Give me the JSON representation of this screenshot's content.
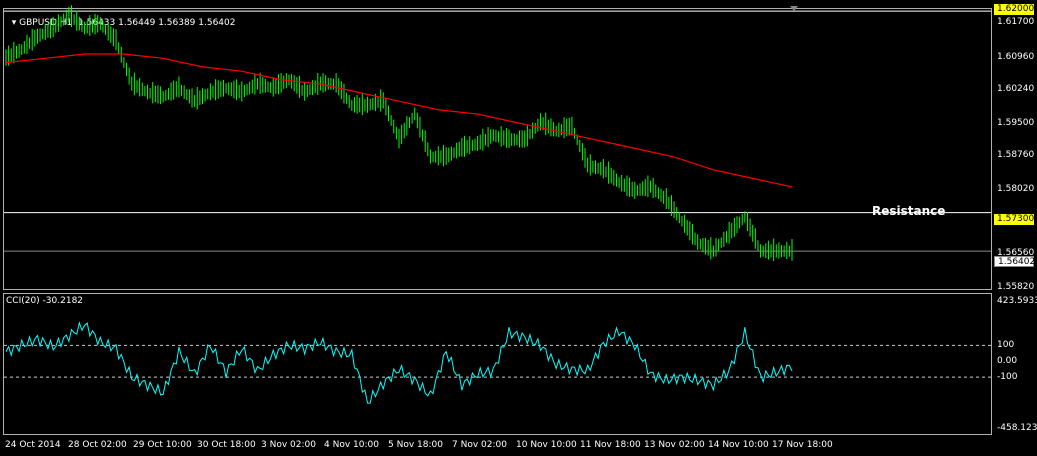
{
  "header": {
    "symbol": "GBPUSD,H1",
    "ohlc": "1.56433 1.56449 1.56389 1.56402"
  },
  "cci": {
    "label": "CCI(20) -30.2182",
    "axis": [
      "423.5933",
      "100",
      "0.00",
      "-100",
      "-458.1239"
    ]
  },
  "price_axis": [
    "1.61700",
    "1.60960",
    "1.60240",
    "1.59500",
    "1.58760",
    "1.58020",
    "1.56560",
    "1.55820"
  ],
  "tags": {
    "top_level": "1.62000",
    "resistance_level": "1.57300",
    "current_price": "1.56402"
  },
  "annotation": {
    "resistance": "Resistance"
  },
  "time_axis": [
    "24 Oct 2014",
    "28 Oct 02:00",
    "29 Oct 10:00",
    "30 Oct 18:00",
    "3 Nov 02:00",
    "4 Nov 10:00",
    "5 Nov 18:00",
    "7 Nov 02:00",
    "10 Nov 10:00",
    "11 Nov 18:00",
    "13 Nov 02:00",
    "14 Nov 10:00",
    "17 Nov 18:00"
  ],
  "colors": {
    "bars": "#00ff00",
    "ma": "#ff0000",
    "cci": "#00ffff",
    "background": "#000000",
    "levels": "#ffffff"
  },
  "chart_data": [
    {
      "type": "line",
      "series": [
        {
          "values": [
            1.609,
            1.611,
            1.614,
            1.616,
            1.619,
            1.616,
            1.617,
            1.613,
            1.603,
            1.601,
            1.6,
            1.602,
            1.599,
            1.601,
            1.602,
            1.601,
            1.603,
            1.602,
            1.604,
            1.601,
            1.603,
            1.603,
            1.598,
            1.598,
            1.599,
            1.59,
            1.596,
            1.586,
            1.586,
            1.588,
            1.589,
            1.591,
            1.59,
            1.59,
            1.594,
            1.592,
            1.593,
            1.584,
            1.583,
            1.58,
            1.578,
            1.579,
            1.576,
            1.571,
            1.566,
            1.564,
            1.568,
            1.572,
            1.564,
            1.564,
            1.564
          ]
        },
        {
          "values": [
            1.608,
            1.609,
            1.61,
            1.61,
            1.609,
            1.607,
            1.606,
            1.604,
            1.603,
            1.601,
            1.599,
            1.597,
            1.596,
            1.594,
            1.592,
            1.59,
            1.588,
            1.586,
            1.583,
            1.581,
            1.579
          ]
        }
      ],
      "levels": [
        1.62,
        1.573,
        1.56402
      ],
      "ylim": [
        1.5552,
        1.6205
      ]
    },
    {
      "type": "line",
      "series": [
        {
          "values": [
            60,
            100,
            140,
            90,
            160,
            230,
            120,
            80,
            -100,
            -150,
            -200,
            60,
            -80,
            100,
            -70,
            80,
            -60,
            40,
            100,
            80,
            120,
            60,
            40,
            -260,
            -140,
            -50,
            -120,
            -220,
            60,
            -150,
            -80,
            -60,
            180,
            150,
            100,
            -20,
            -50,
            -60,
            110,
            190,
            100,
            -80,
            -120,
            -100,
            -120,
            -150,
            -60,
            180,
            -100,
            -70,
            -30
          ]
        }
      ],
      "levels": [
        100,
        0,
        -100
      ],
      "ylim": [
        -458.1239,
        423.5933
      ]
    }
  ]
}
